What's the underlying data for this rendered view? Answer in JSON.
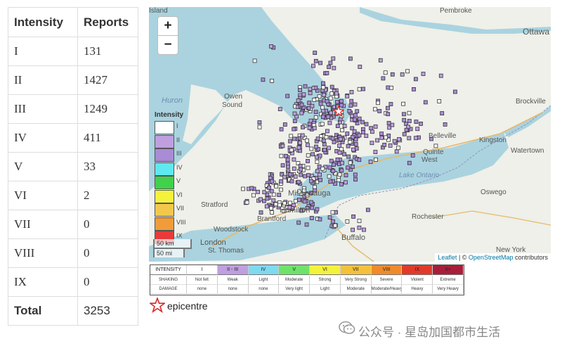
{
  "table": {
    "headers": [
      "Intensity",
      "Reports"
    ],
    "rows": [
      {
        "intensity": "I",
        "reports": "131"
      },
      {
        "intensity": "II",
        "reports": "1427"
      },
      {
        "intensity": "III",
        "reports": "1249"
      },
      {
        "intensity": "IV",
        "reports": "411"
      },
      {
        "intensity": "V",
        "reports": "33"
      },
      {
        "intensity": "VI",
        "reports": "2"
      },
      {
        "intensity": "VII",
        "reports": "0"
      },
      {
        "intensity": "VIII",
        "reports": "0"
      },
      {
        "intensity": "IX",
        "reports": "0"
      }
    ],
    "total_label": "Total",
    "total_value": "3253"
  },
  "map": {
    "zoom_in": "+",
    "zoom_out": "−",
    "legend_title": "Intensity",
    "legend": [
      {
        "level": "I",
        "color": "#ffffff"
      },
      {
        "level": "II",
        "color": "#bf9fe0"
      },
      {
        "level": "III",
        "color": "#a98bd6"
      },
      {
        "level": "IV",
        "color": "#5fe8ef"
      },
      {
        "level": "V",
        "color": "#3fd24a"
      },
      {
        "level": "VI",
        "color": "#f4f23a"
      },
      {
        "level": "VII",
        "color": "#f2c84a"
      },
      {
        "level": "VIII",
        "color": "#f09c3a"
      },
      {
        "level": "IX",
        "color": "#e83a3a"
      }
    ],
    "scale_km": "50 km",
    "scale_mi": "50 mi",
    "attribution_leaflet": "Leaflet",
    "attribution_sep": " | © ",
    "attribution_osm": "OpenStreetMap",
    "attribution_suffix": " contributors",
    "places": [
      {
        "name": "Island",
        "kind": "land"
      },
      {
        "name": "Pembroke",
        "kind": "land"
      },
      {
        "name": "Ottawa",
        "kind": "land"
      },
      {
        "name": "Huron",
        "kind": "water"
      },
      {
        "name": "Owen",
        "kind": "land"
      },
      {
        "name": "Sound",
        "kind": "land"
      },
      {
        "name": "Brockville",
        "kind": "land"
      },
      {
        "name": "Belleville",
        "kind": "land"
      },
      {
        "name": "Kingston",
        "kind": "land"
      },
      {
        "name": "Quinte",
        "kind": "land"
      },
      {
        "name": "West",
        "kind": "land"
      },
      {
        "name": "Watertown",
        "kind": "land"
      },
      {
        "name": "Lake Ontario",
        "kind": "water"
      },
      {
        "name": "Mississauga",
        "kind": "land"
      },
      {
        "name": "Stratford",
        "kind": "land"
      },
      {
        "name": "Oswego",
        "kind": "land"
      },
      {
        "name": "Brantford",
        "kind": "land"
      },
      {
        "name": "Hamilton",
        "kind": "land"
      },
      {
        "name": "Woodstock",
        "kind": "land"
      },
      {
        "name": "Rochester",
        "kind": "land"
      },
      {
        "name": "London",
        "kind": "land"
      },
      {
        "name": "St. Thomas",
        "kind": "land"
      },
      {
        "name": "Buffalo",
        "kind": "land"
      },
      {
        "name": "New York",
        "kind": "land"
      }
    ]
  },
  "intensity_scale": {
    "row_labels": [
      "INTENSITY",
      "SHAKING",
      "DAMAGE"
    ],
    "columns": [
      {
        "intensity": "I",
        "shaking": "Not felt",
        "damage": "none",
        "color": "#ffffff"
      },
      {
        "intensity": "II - III",
        "shaking": "Weak",
        "damage": "none",
        "color": "#bf9fe0"
      },
      {
        "intensity": "IV",
        "shaking": "Light",
        "damage": "none",
        "color": "#7fd9f0"
      },
      {
        "intensity": "V",
        "shaking": "Moderate",
        "damage": "Very light",
        "color": "#6ee36a"
      },
      {
        "intensity": "VI",
        "shaking": "Strong",
        "damage": "Light",
        "color": "#f4f23a"
      },
      {
        "intensity": "VII",
        "shaking": "Very Strong",
        "damage": "Moderate",
        "color": "#f5c13a"
      },
      {
        "intensity": "VIII",
        "shaking": "Severe",
        "damage": "Moderate/Heavy",
        "color": "#f08a2a"
      },
      {
        "intensity": "IX",
        "shaking": "Violent",
        "damage": "Heavy",
        "color": "#e23a2a"
      },
      {
        "intensity": "X+",
        "shaking": "Extreme",
        "damage": "Very Heavy",
        "color": "#a81e3a"
      }
    ]
  },
  "epicentre": {
    "label": "epicentre",
    "color": "#d62a2a"
  },
  "watermark": {
    "text": "公众号 · 星岛加国都市生活"
  }
}
